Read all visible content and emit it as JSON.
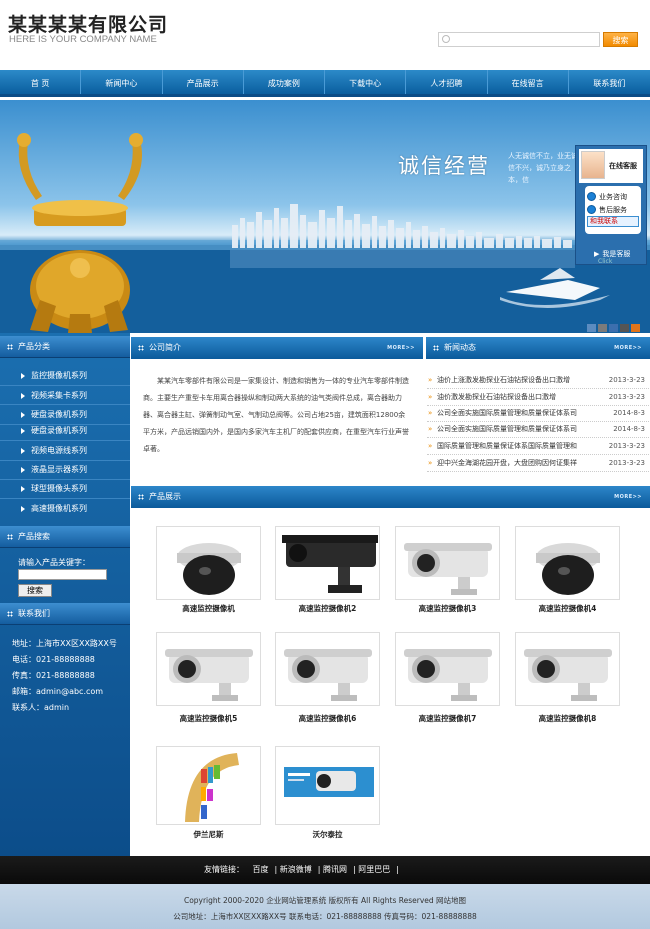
{
  "header": {
    "company_name": "某某某某有限公司",
    "company_slogan": "HERE IS YOUR COMPANY NAME",
    "search_button": "搜索"
  },
  "nav": [
    "首 页",
    "新闻中心",
    "产品展示",
    "成功案例",
    "下载中心",
    "人才招聘",
    "在线留言",
    "联系我们"
  ],
  "banner": {
    "title": "诚信经营",
    "subtitle": "人无诚信不立，业无诚信不兴，诚乃立身之本，信"
  },
  "customer_service": {
    "title": "在线客服",
    "items": [
      "业务咨询",
      "售后服务",
      "和我联系"
    ],
    "close": "我是客服",
    "close_en": "Click"
  },
  "sidebar": {
    "categories_title": "产品分类",
    "categories": [
      "监控摄像机系列",
      "视频采集卡系列",
      "硬盘录像机系列",
      "硬盘录像机系列",
      "视频电源线系列",
      "液晶显示器系列",
      "球型摄像头系列",
      "高速摄像机系列"
    ],
    "search_title": "产品搜索",
    "search_label": "请输入产品关键字：",
    "search_button": "搜索",
    "contact_title": "联系我们",
    "contact": [
      "地址：上海市XX区XX路XX号",
      "电话：021-88888888",
      "传真：021-88888888",
      "邮箱：admin@abc.com",
      "联系人：admin"
    ]
  },
  "company": {
    "title": "公司简介",
    "more": "MORE>>",
    "text": "某某汽车零部件有限公司是一家集设计、制造和销售为一体的专业汽车零部件制造商。主要生产重型卡车用离合器操纵和制动两大系统的油气类阀件总成，离合器助力器、离合器主缸、弹簧制动气室、气制动总阀等。公司占地25亩，建筑面积12800余平方米，产品远销国内外，是国内多家汽车主机厂的配套供应商，在重型汽车行业声誉卓著。"
  },
  "news": {
    "title": "新闻动态",
    "more": "MORE>>",
    "items": [
      {
        "title": "油价上涨激发勘探业石油钻探设备出口激增",
        "date": "2013-3-23"
      },
      {
        "title": "油价激发勘探业石油钻探设备出口激增",
        "date": "2013-3-23"
      },
      {
        "title": "公司全面实施国际质量管理和质量保证体系司",
        "date": "2014-8-3"
      },
      {
        "title": "公司全面实施国际质量管理和质量保证体系司",
        "date": "2014-8-3"
      },
      {
        "title": "国际质量管理和质量保证体系国际质量管理和",
        "date": "2013-3-23"
      },
      {
        "title": "迎中兴金海湖花园开盘，大盘团购因何证集祥",
        "date": "2013-3-23"
      }
    ]
  },
  "products": {
    "title": "产品展示",
    "more": "MORE>>",
    "items": [
      "高速监控摄像机",
      "高速监控摄像机2",
      "高速监控摄像机3",
      "高速监控摄像机4",
      "高速监控摄像机5",
      "高速监控摄像机6",
      "高速监控摄像机7",
      "高速监控摄像机8",
      "伊兰尼斯",
      "沃尔泰拉"
    ]
  },
  "footer": {
    "links_label": "友情链接：",
    "links": [
      "百度",
      "新浪微博",
      "腾讯网",
      "阿里巴巴"
    ],
    "copyright": "Copyright 2000-2020 企业网站管理系统 版权所有 All Rights Reserved  网站地图",
    "address": "公司地址：上海市XX区XX路XX号  联系电话：021-88888888  传真号码：021-88888888"
  }
}
